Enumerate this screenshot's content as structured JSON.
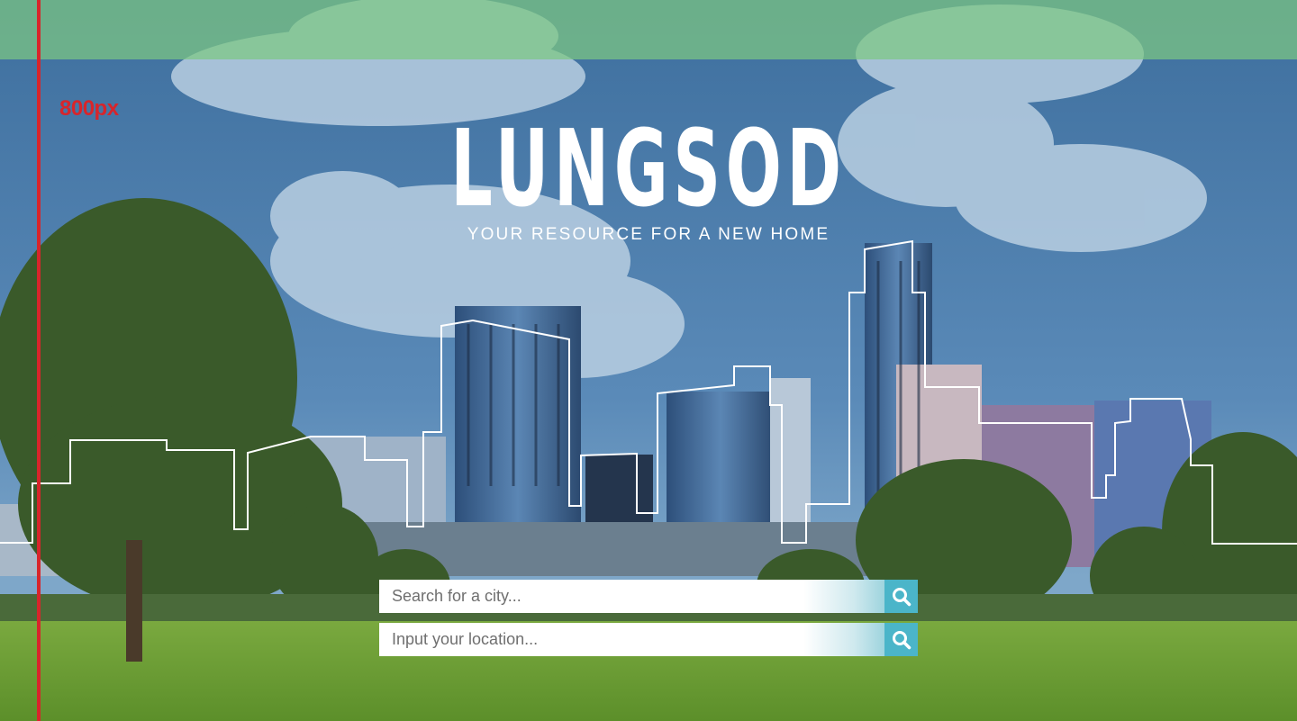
{
  "header": {
    "brand": "LUNGSOD",
    "tagline": "YOUR RESOURCE FOR A NEW HOME"
  },
  "guide": {
    "label": "800px"
  },
  "search": {
    "city_placeholder": "Search for a city...",
    "location_placeholder": "Input your location...",
    "icon": "search-icon"
  },
  "colors": {
    "accent": "#4bb5c9",
    "guide": "#d8252b",
    "topbar": "#7dc882"
  }
}
